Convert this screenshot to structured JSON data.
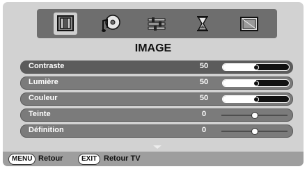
{
  "menu": {
    "title": "IMAGE",
    "icons": [
      {
        "name": "picture-menu-icon",
        "selected": true
      },
      {
        "name": "sound-menu-icon",
        "selected": false
      },
      {
        "name": "settings-menu-icon",
        "selected": false
      },
      {
        "name": "timer-menu-icon",
        "selected": false
      },
      {
        "name": "installation-menu-icon",
        "selected": false
      }
    ]
  },
  "settings": [
    {
      "label": "Contraste",
      "value": "50",
      "level": 0.5,
      "type": "bar",
      "selected": true
    },
    {
      "label": "Lumière",
      "value": "50",
      "level": 0.5,
      "type": "bar",
      "selected": false
    },
    {
      "label": "Couleur",
      "value": "50",
      "level": 0.5,
      "type": "bar",
      "selected": false
    },
    {
      "label": "Teinte",
      "value": "0",
      "level": 0.5,
      "type": "center",
      "selected": false
    },
    {
      "label": "Définition",
      "value": "0",
      "level": 0.5,
      "type": "center",
      "selected": false
    }
  ],
  "footer": {
    "menu_key": "MENU",
    "menu_text": "Retour",
    "exit_key": "EXIT",
    "exit_text": "Retour TV"
  }
}
